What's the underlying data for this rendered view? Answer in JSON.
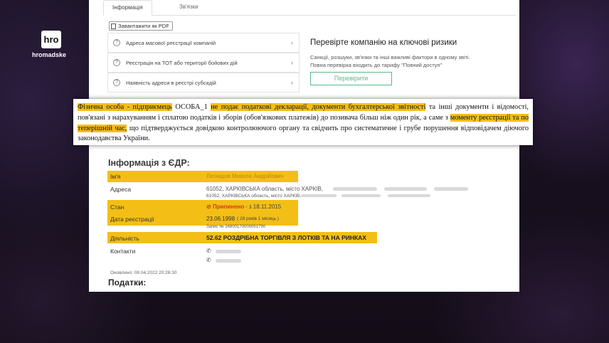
{
  "channel": {
    "logo_box": "hro",
    "name": "hromadske"
  },
  "tabs": [
    "Інформація",
    "Зв'язки"
  ],
  "pdf_button": "Завантажити як PDF",
  "accordion": [
    "Адреса масової реєстрації компаній",
    "Реєстрація на ТОТ або території бойових дій",
    "Наявність адреси в реєстрі субсидій"
  ],
  "risk": {
    "title": "Перевірте компанію на ключові ризики",
    "desc_1": "Санкції, розшуки, зв'язки та інші важливі фактори в одному звіті.",
    "desc_2": "Повна перевірка входить до тарифу \"Повний доступ\"",
    "button": "Перевірити"
  },
  "quote": {
    "p1_mark": "Фізична особа - підприємець",
    "p2": " ОСОБА_1 ",
    "p3_mark": "не подає податкові декларації, документи бухгалтерської звітності",
    "p4": " та інші документи і відомості, пов'язані з нарахуванням і сплатою податків і зборів (обов'язкових платежів) до позивача більш ніж один рік, а саме з ",
    "p5_mark": "моменту реєстрації та по теперішній час,",
    "p6": " що підтверджується довідкою контролюючого органу та свідчить про систематичне і грубе порушення відповідачем діючого законодавства України."
  },
  "edr": {
    "title": "Інформація з ЄДР:",
    "name_label": "Ім'я",
    "name_value": "Леонідов Микола Андрійович",
    "address_label": "Адреса",
    "address_line1": "61052, ХАРКІВСЬКА область, місто ХАРКІВ,",
    "address_line2": "61052, ХАРКІВСЬКА область, місто ХАРКІВ,",
    "status_label": "Стан",
    "status_value": "Припинено",
    "status_date": "- з 18.11.2015",
    "regdate_label": "Дата реєстрації",
    "regdate_value": "23.06.1998",
    "regdate_age": "( 28 років 1 місяць )",
    "record": "Запис № 24800170000051790",
    "activity_label": "Діяльність",
    "activity_value": "52.62 РОЗДРІБНА ТОРГІВЛЯ З ЛОТКІВ ТА НА РИНКАХ",
    "contacts_label": "Контакти",
    "updated": "Оновлено: 08.04.2022 20:26:30",
    "taxes_title": "Податки:"
  }
}
